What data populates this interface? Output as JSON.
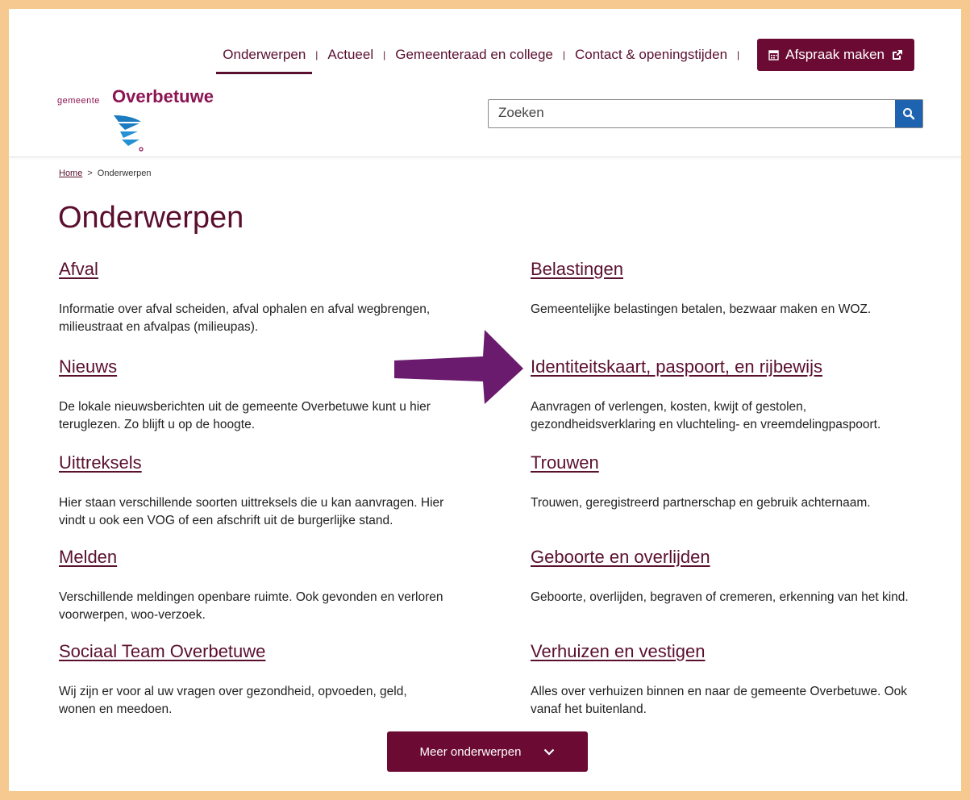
{
  "nav": {
    "items": [
      "Onderwerpen",
      "Actueel",
      "Gemeenteraad en college",
      "Contact & openingstijden"
    ],
    "appointment_label": "Afspraak maken"
  },
  "logo": {
    "prefix": "gemeente",
    "name": "Overbetuwe"
  },
  "search": {
    "placeholder": "Zoeken"
  },
  "breadcrumb": {
    "home": "Home",
    "current": "Onderwerpen"
  },
  "page": {
    "title": "Onderwerpen"
  },
  "topics": [
    {
      "title": "Afval",
      "desc": "Informatie over afval scheiden, afval ophalen en afval wegbrengen, milieustraat en afvalpas (milieupas)."
    },
    {
      "title": "Belastingen",
      "desc": "Gemeentelijke belastingen betalen, bezwaar maken en WOZ."
    },
    {
      "title": "Nieuws",
      "desc": "De lokale nieuwsberichten uit de gemeente Overbetuwe kunt u hier teruglezen. Zo blijft u op de hoogte."
    },
    {
      "title": "Identiteitskaart, paspoort, en rijbewijs",
      "desc": "Aanvragen of verlengen, kosten, kwijt of gestolen, gezondheidsverklaring en vluchteling- en vreemdelingpaspoort."
    },
    {
      "title": "Uittreksels",
      "desc": "Hier staan verschillende soorten uittreksels die u kan aanvragen. Hier vindt u ook een VOG of een afschrift uit de burgerlijke stand."
    },
    {
      "title": "Trouwen",
      "desc": "Trouwen, geregistreerd partnerschap en gebruik achternaam."
    },
    {
      "title": "Melden",
      "desc": "Verschillende meldingen openbare ruimte. Ook gevonden en verloren voorwerpen, woo-verzoek."
    },
    {
      "title": "Geboorte en overlijden",
      "desc": "Geboorte, overlijden, begraven of cremeren, erkenning van het kind."
    },
    {
      "title": "Sociaal Team Overbetuwe",
      "desc": "Wij zijn er voor al uw vragen over gezondheid, opvoeden, geld, wonen en meedoen."
    },
    {
      "title": "Verhuizen en vestigen",
      "desc": "Alles over verhuizen binnen en naar de gemeente Overbetuwe. Ook vanaf het buitenland."
    }
  ],
  "more_button": {
    "label": "Meer onderwerpen"
  },
  "colors": {
    "brand": "#6b0a33",
    "text_brand": "#5a0f2e",
    "arrow": "#6a1b6e",
    "search_button": "#1d63b0",
    "frame": "#f5c98f"
  }
}
